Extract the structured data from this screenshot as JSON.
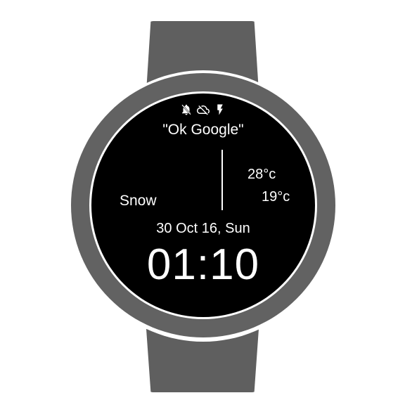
{
  "status_icons": [
    "notifications-off-icon",
    "cloud-off-icon",
    "charging-bolt-icon"
  ],
  "voice_hint": "\"Ok Google\"",
  "weather": {
    "high": "28°c",
    "low": "19°c",
    "condition": "Snow"
  },
  "date": "30 Oct 16, Sun",
  "time": "01:10",
  "colors": {
    "strap": "#5f5f5f",
    "case": "#626262",
    "face": "#000000",
    "text": "#ffffff"
  }
}
